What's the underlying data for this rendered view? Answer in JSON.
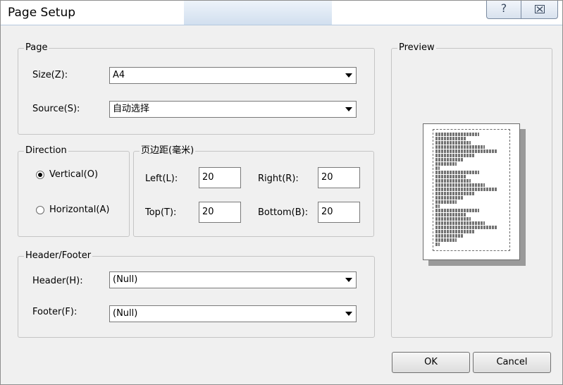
{
  "window": {
    "title": "Page Setup",
    "help_glyph": "?",
    "close_glyph": "☒"
  },
  "page": {
    "legend": "Page",
    "size_label": "Size(Z):",
    "size_value": "A4",
    "source_label": "Source(S):",
    "source_value": "自动选择"
  },
  "direction": {
    "legend": "Direction",
    "vertical_label": "Vertical(O)",
    "horizontal_label": "Horizontal(A)",
    "selected": "Vertical(O)"
  },
  "margins": {
    "legend": "页边距(毫米)",
    "left_label": "Left(L):",
    "left_value": "20",
    "right_label": "Right(R):",
    "right_value": "20",
    "top_label": "Top(T):",
    "top_value": "20",
    "bottom_label": "Bottom(B):",
    "bottom_value": "20"
  },
  "header_footer": {
    "legend": "Header/Footer",
    "header_label": "Header(H):",
    "header_value": "(Null)",
    "footer_label": "Footer(F):",
    "footer_value": "(Null)"
  },
  "preview": {
    "legend": "Preview"
  },
  "buttons": {
    "ok": "OK",
    "cancel": "Cancel"
  }
}
